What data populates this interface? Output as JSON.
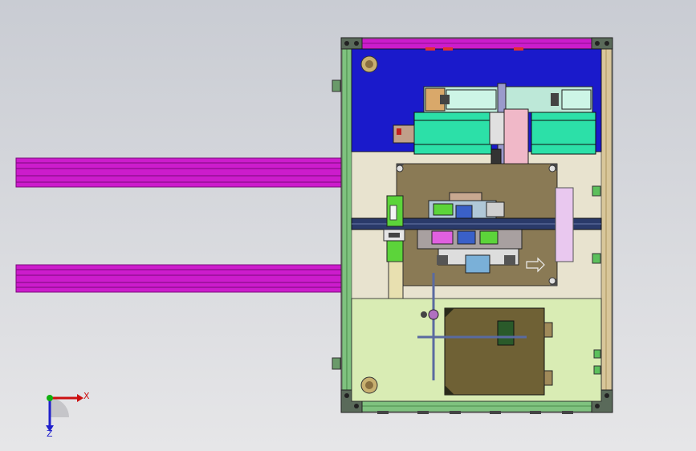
{
  "viewport": {
    "background_top": "#c9ccd3",
    "background_bottom": "#e6e6e8"
  },
  "colors": {
    "rail": "#cc1ccc",
    "rail_edge": "#7a0a7a",
    "frame_green": "#7fc27f",
    "frame_beige": "#d8c69a",
    "top_plate": "#1a1acb",
    "bottom_plate": "#d9ecb4",
    "mid_plate": "#8a7a55",
    "crossbar": "#2a3a6a",
    "module_cyan": "#2ce0a8",
    "module_tan": "#d9a86a",
    "pink_slide": "#f0b8c8",
    "bright_green": "#5cd43a",
    "box_olive": "#6f6135",
    "lavender": "#e9c8ef",
    "dark_green": "#2a5a2a"
  },
  "triad": {
    "x_label": "X",
    "z_label": "Z",
    "icon": "coordinate-axis-triad-icon"
  },
  "mid_plate": {
    "arrow_icon": "direction-arrow-icon"
  }
}
